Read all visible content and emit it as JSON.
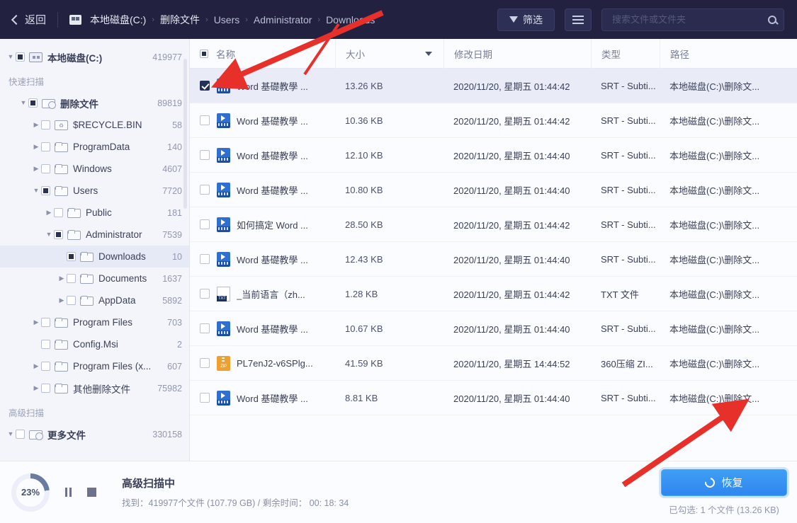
{
  "topbar": {
    "back_label": "返回",
    "breadcrumbs": [
      "本地磁盘(C:)",
      "删除文件",
      "Users",
      "Administrator",
      "Downloads"
    ],
    "separator": "›",
    "filter_label": "筛选",
    "search_placeholder": "搜索文件或文件夹",
    "search_value": ""
  },
  "sidebar": {
    "sections": [
      {
        "label": "快速扫描"
      },
      {
        "label": "高级扫描"
      }
    ],
    "root": {
      "label": "本地磁盘(C:)",
      "count": "419977"
    },
    "items": [
      {
        "label": "删除文件",
        "count": "89819",
        "indent": 1,
        "arrow": "d",
        "check": "part",
        "icon": "deleted-files"
      },
      {
        "label": "$RECYCLE.BIN",
        "count": "58",
        "indent": 2,
        "arrow": "r",
        "check": "none",
        "icon": "recycle"
      },
      {
        "label": "ProgramData",
        "count": "140",
        "indent": 2,
        "arrow": "r",
        "check": "none",
        "icon": "folder"
      },
      {
        "label": "Windows",
        "count": "4607",
        "indent": 2,
        "arrow": "r",
        "check": "none",
        "icon": "folder"
      },
      {
        "label": "Users",
        "count": "7720",
        "indent": 2,
        "arrow": "d",
        "check": "part",
        "icon": "folder"
      },
      {
        "label": "Public",
        "count": "181",
        "indent": 3,
        "arrow": "r",
        "check": "none",
        "icon": "folder"
      },
      {
        "label": "Administrator",
        "count": "7539",
        "indent": 3,
        "arrow": "d",
        "check": "part",
        "icon": "folder"
      },
      {
        "label": "Downloads",
        "count": "10",
        "indent": 4,
        "arrow": "none",
        "check": "part",
        "icon": "folder",
        "selected": true
      },
      {
        "label": "Documents",
        "count": "1637",
        "indent": 4,
        "arrow": "r",
        "check": "none",
        "icon": "folder"
      },
      {
        "label": "AppData",
        "count": "5892",
        "indent": 4,
        "arrow": "r",
        "check": "none",
        "icon": "folder"
      },
      {
        "label": "Program Files",
        "count": "703",
        "indent": 2,
        "arrow": "r",
        "check": "none",
        "icon": "folder"
      },
      {
        "label": "Config.Msi",
        "count": "2",
        "indent": 2,
        "arrow": "none",
        "check": "none",
        "icon": "folder"
      },
      {
        "label": "Program Files (x...",
        "count": "607",
        "indent": 2,
        "arrow": "r",
        "check": "none",
        "icon": "folder"
      },
      {
        "label": "其他删除文件",
        "count": "75982",
        "indent": 2,
        "arrow": "r",
        "check": "none",
        "icon": "folder"
      }
    ],
    "more_files": {
      "label": "更多文件",
      "count": "330158"
    }
  },
  "table": {
    "columns": [
      "名称",
      "大小",
      "修改日期",
      "类型",
      "路径"
    ],
    "rows": [
      {
        "checked": true,
        "icon": "srt",
        "name": "Word 基礎教學 ...",
        "size": "13.26 KB",
        "date": "2020/11/20, 星期五 01:44:42",
        "type": "SRT - Subti...",
        "path": "本地磁盘(C:)\\删除文..."
      },
      {
        "checked": false,
        "icon": "srt",
        "name": "Word 基礎教學 ...",
        "size": "10.36 KB",
        "date": "2020/11/20, 星期五 01:44:42",
        "type": "SRT - Subti...",
        "path": "本地磁盘(C:)\\删除文..."
      },
      {
        "checked": false,
        "icon": "srt",
        "name": "Word 基礎教學 ...",
        "size": "12.10 KB",
        "date": "2020/11/20, 星期五 01:44:40",
        "type": "SRT - Subti...",
        "path": "本地磁盘(C:)\\删除文..."
      },
      {
        "checked": false,
        "icon": "srt",
        "name": "Word 基礎教學 ...",
        "size": "10.80 KB",
        "date": "2020/11/20, 星期五 01:44:40",
        "type": "SRT - Subti...",
        "path": "本地磁盘(C:)\\删除文..."
      },
      {
        "checked": false,
        "icon": "srt",
        "name": "如何搞定 Word ...",
        "size": "28.50 KB",
        "date": "2020/11/20, 星期五 01:44:42",
        "type": "SRT - Subti...",
        "path": "本地磁盘(C:)\\删除文..."
      },
      {
        "checked": false,
        "icon": "srt",
        "name": "Word 基礎教學 ...",
        "size": "12.43 KB",
        "date": "2020/11/20, 星期五 01:44:40",
        "type": "SRT - Subti...",
        "path": "本地磁盘(C:)\\删除文..."
      },
      {
        "checked": false,
        "icon": "txt",
        "name": "_当前语言（zh...",
        "size": "1.28 KB",
        "date": "2020/11/20, 星期五 01:44:42",
        "type": "TXT 文件",
        "path": "本地磁盘(C:)\\删除文..."
      },
      {
        "checked": false,
        "icon": "srt",
        "name": "Word 基礎教學 ...",
        "size": "10.67 KB",
        "date": "2020/11/20, 星期五 01:44:40",
        "type": "SRT - Subti...",
        "path": "本地磁盘(C:)\\删除文..."
      },
      {
        "checked": false,
        "icon": "zip",
        "name": "PL7enJ2-v6SPlg...",
        "size": "41.59 KB",
        "date": "2020/11/20, 星期五 14:44:52",
        "type": "360压缩 ZI...",
        "path": "本地磁盘(C:)\\删除文..."
      },
      {
        "checked": false,
        "icon": "srt",
        "name": "Word 基礎教學 ...",
        "size": "8.81 KB",
        "date": "2020/11/20, 星期五 01:44:40",
        "type": "SRT - Subti...",
        "path": "本地磁盘(C:)\\删除文..."
      }
    ]
  },
  "footer": {
    "progress_percent": "23%",
    "status_title": "高级扫描中",
    "status_detail": "找到：419977个文件 (107.79 GB) / 剩余时间： 00: 18: 34",
    "restore_label": "恢复",
    "selection_info": "已勾选: 1 个文件 (13.26 KB)"
  },
  "colors": {
    "topbar_bg": "#222240",
    "accent": "#2f86ef",
    "annotation_arrow": "#e8302a",
    "sidebar_bg": "#f4f5fb"
  }
}
